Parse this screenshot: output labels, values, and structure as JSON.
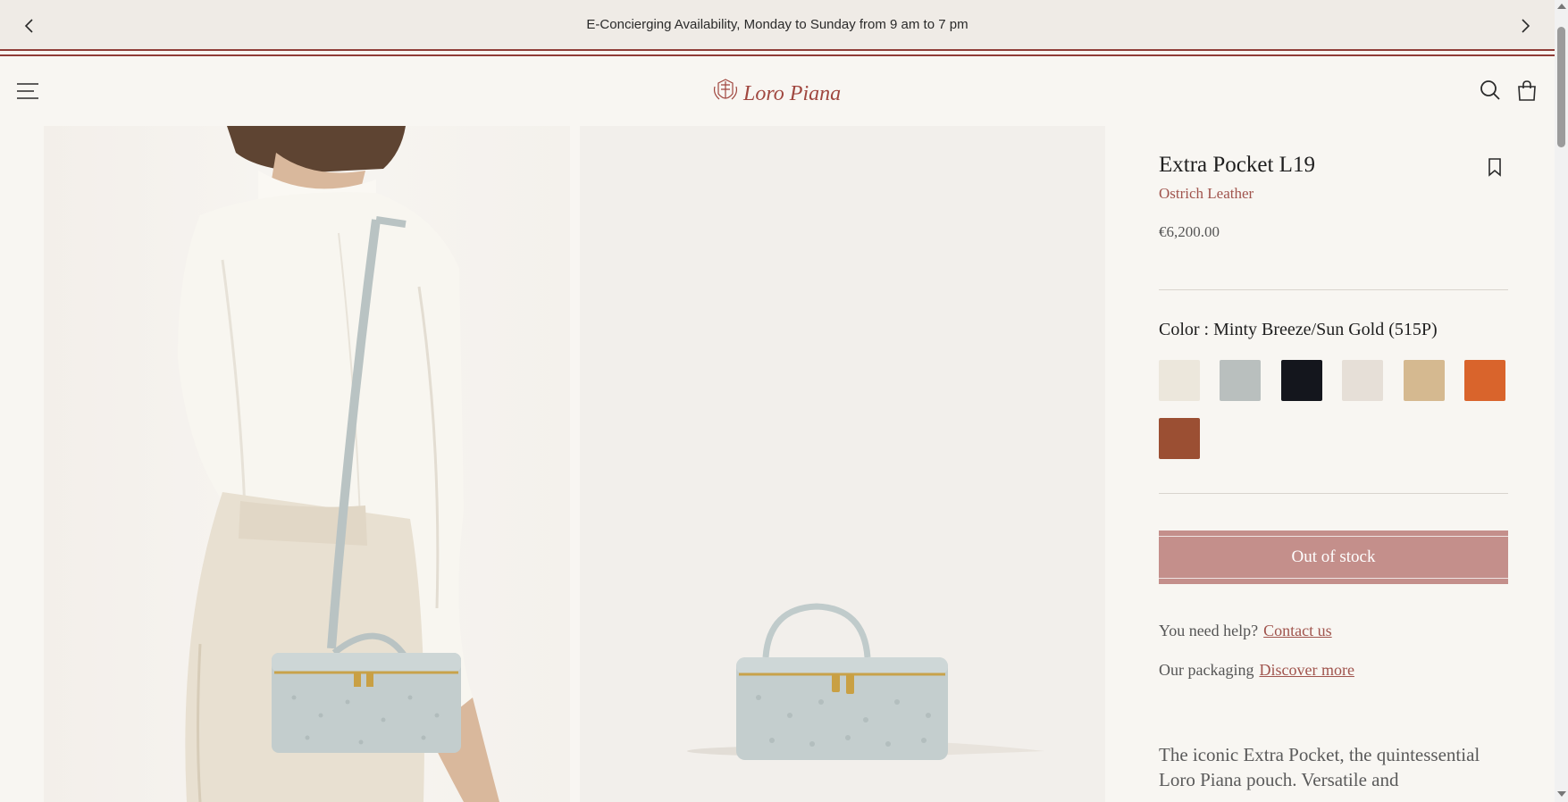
{
  "announcement": {
    "text": "E-Concierging Availability, Monday to Sunday from 9 am to 7 pm",
    "prev_icon": "chevron-left-icon",
    "next_icon": "chevron-right-icon"
  },
  "header": {
    "menu_icon": "hamburger-menu-icon",
    "logo_text": "Loro Piana",
    "search_icon": "search-icon",
    "bag_icon": "shopping-bag-icon"
  },
  "gallery": {
    "images": [
      "model-wearing-bag-image",
      "bag-product-image"
    ]
  },
  "product": {
    "title": "Extra Pocket L19",
    "material": "Ostrich Leather",
    "price": "€6,200.00",
    "color_label": "Color : Minty Breeze/Sun Gold (515P)",
    "swatches": [
      {
        "name": "ivory",
        "color": "#ece7dc"
      },
      {
        "name": "minty-breeze",
        "color": "#b9bfbe"
      },
      {
        "name": "black",
        "color": "#14161d"
      },
      {
        "name": "cream",
        "color": "#e6dfd7"
      },
      {
        "name": "beige",
        "color": "#d5b990"
      },
      {
        "name": "orange",
        "color": "#d9642c"
      },
      {
        "name": "cognac",
        "color": "#9b4f33"
      }
    ],
    "stock_button": "Out of stock",
    "help_text": "You need help?",
    "help_link": "Contact us",
    "packaging_text": "Our packaging",
    "packaging_link": "Discover more",
    "description": "The iconic Extra Pocket, the quintessential Loro Piana pouch. Versatile and"
  },
  "colors": {
    "accent": "#a0544d",
    "brand_rule": "#8f3d38",
    "button": "#c48f8b"
  }
}
